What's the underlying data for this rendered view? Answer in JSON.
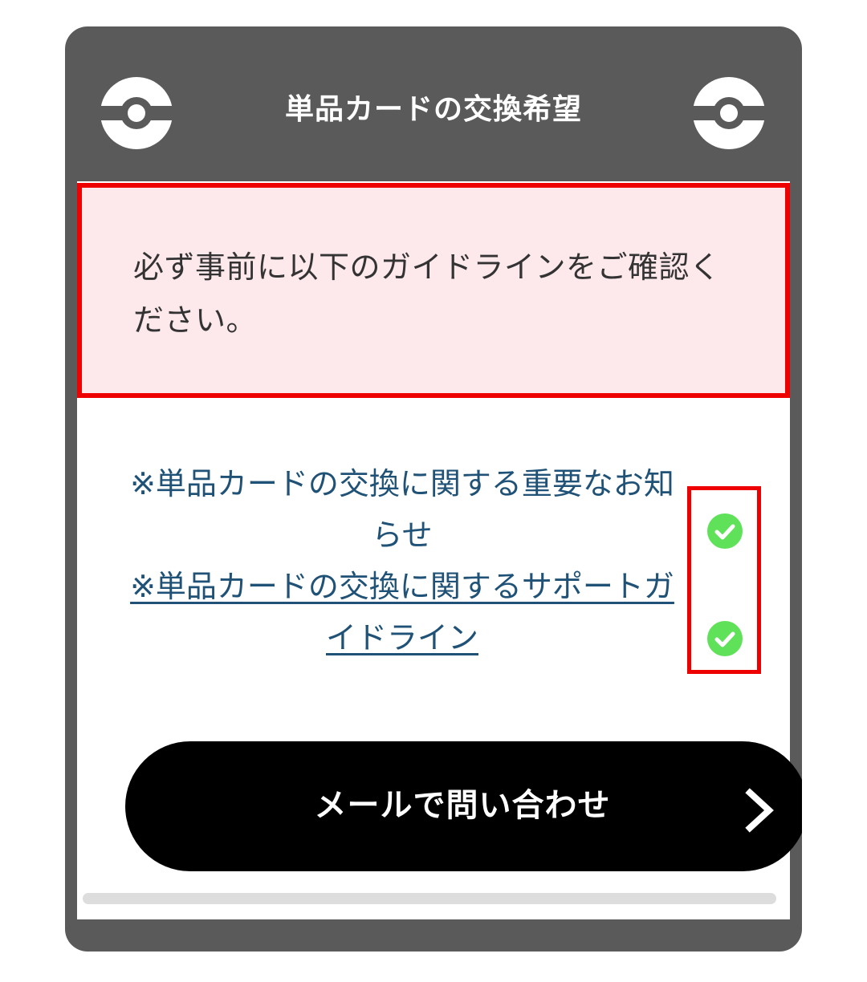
{
  "header": {
    "title": "単品カードの交換希望",
    "left_icon": "pokeball-icon",
    "right_icon": "pokeball-icon"
  },
  "notice": {
    "text": "必ず事前に以下のガイドラインをご確認ください。"
  },
  "links": [
    {
      "label": "※単品カードの交換に関する重要なお知らせ"
    },
    {
      "label": "※単品カードの交換に関するサポートガイドライン"
    }
  ],
  "checks": {
    "icon": "check-circle-icon",
    "color": "#5fe25a"
  },
  "mail_button": {
    "label": "メールで問い合わせ",
    "icon": "chevron-right-icon"
  },
  "colors": {
    "frame": "#5b5a5b",
    "notice_border": "#ee0000",
    "notice_background": "#fde9ec",
    "link": "#1f5276",
    "button": "#000000"
  }
}
